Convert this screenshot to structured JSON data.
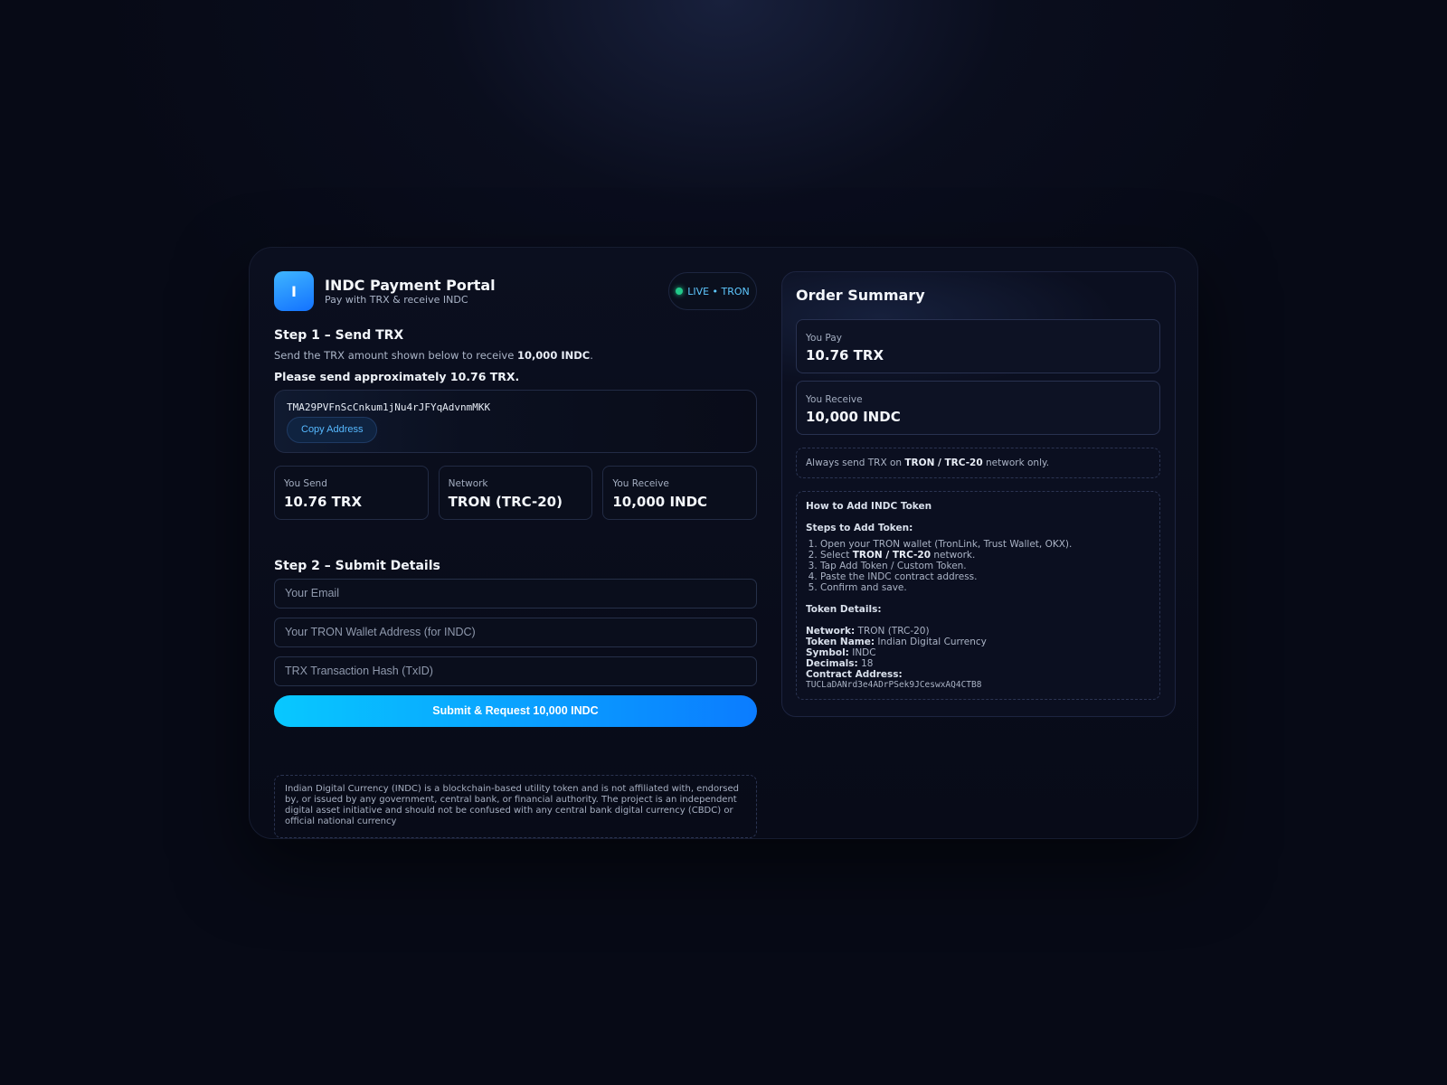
{
  "brand": {
    "logo_letter": "I",
    "title": "INDC Payment Portal",
    "subtitle": "Pay with TRX & receive INDC",
    "status": "LIVE • TRON",
    "status_color": "#22c98a"
  },
  "step1": {
    "heading": "Step 1 – Send TRX",
    "desc_prefix": "Send the TRX amount shown below to receive ",
    "desc_amount": "10,000 INDC",
    "desc_suffix": ".",
    "please": "Please send approximately 10.76 TRX.",
    "address": "TMA29PVFnScCnkum1jNu4rJFYqAdvnmMKK",
    "copy_label": "Copy Address"
  },
  "stats": [
    {
      "label": "You Send",
      "value": "10.76 TRX"
    },
    {
      "label": "Network",
      "value": "TRON (TRC-20)"
    },
    {
      "label": "You Receive",
      "value": "10,000 INDC"
    }
  ],
  "step2": {
    "heading": "Step 2 – Submit Details",
    "email_placeholder": "Your Email",
    "wallet_placeholder": "Your TRON Wallet Address (for INDC)",
    "txid_placeholder": "TRX Transaction Hash (TxID)",
    "submit_label": "Submit & Request 10,000 INDC"
  },
  "disclaimer": "Indian Digital Currency (INDC) is a blockchain-based utility token and is not affiliated with, endorsed by, or issued by any government, central bank, or financial authority. The project is an independent digital asset initiative and should not be confused with any central bank digital currency (CBDC) or official national currency",
  "summary": {
    "title": "Order Summary",
    "pay_label": "You Pay",
    "pay_value": "10.76 TRX",
    "receive_label": "You Receive",
    "receive_value": "10,000 INDC",
    "note_prefix": "Always send TRX on ",
    "note_network": "TRON / TRC-20",
    "note_suffix": " network only."
  },
  "howto": {
    "title": "How to Add INDC Token",
    "steps_heading": "Steps to Add Token:",
    "step1": "Open your TRON wallet (TronLink, Trust Wallet, OKX).",
    "step2_prefix": "Select ",
    "step2_network": "TRON / TRC-20",
    "step2_suffix": " network.",
    "step3": "Tap Add Token / Custom Token.",
    "step4": "Paste the INDC contract address.",
    "step5": "Confirm and save.",
    "details_heading": "Token Details:",
    "network_label": "Network:",
    "network_value": " TRON (TRC-20)",
    "name_label": "Token Name:",
    "name_value": " Indian Digital Currency",
    "symbol_label": "Symbol:",
    "symbol_value": " INDC",
    "decimals_label": "Decimals:",
    "decimals_value": " 18",
    "contract_label": "Contract Address:",
    "contract_value": "TUCLaDANrd3e4ADrPSek9JCeswxAQ4CTB8"
  }
}
